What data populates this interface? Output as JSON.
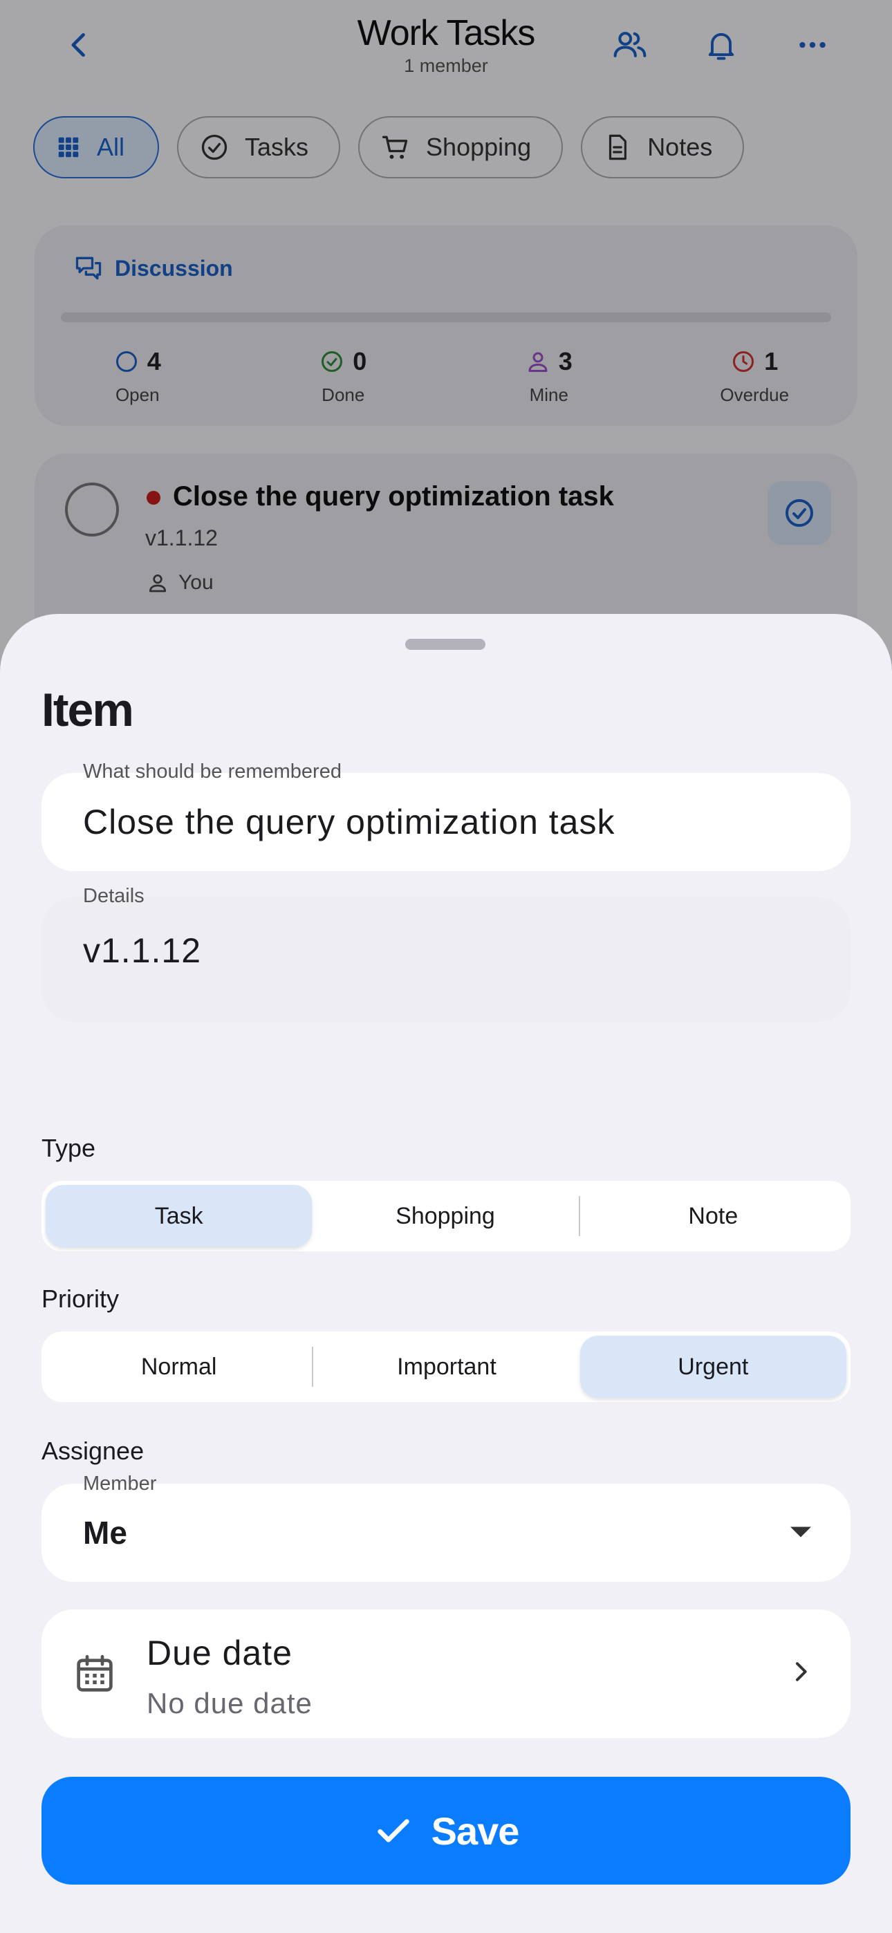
{
  "header": {
    "title": "Work Tasks",
    "subtitle": "1 member"
  },
  "filters": [
    {
      "label": "All",
      "icon": "grid-icon",
      "active": true
    },
    {
      "label": "Tasks",
      "icon": "check-circle-icon",
      "active": false
    },
    {
      "label": "Shopping",
      "icon": "cart-icon",
      "active": false
    },
    {
      "label": "Notes",
      "icon": "document-icon",
      "active": false
    }
  ],
  "discussion": {
    "label": "Discussion",
    "stats": [
      {
        "value": "4",
        "label": "Open",
        "color": "#1a5fc8"
      },
      {
        "value": "0",
        "label": "Done",
        "color": "#2e8b3a"
      },
      {
        "value": "3",
        "label": "Mine",
        "color": "#9b4fc9"
      },
      {
        "value": "1",
        "label": "Overdue",
        "color": "#d03030"
      }
    ]
  },
  "task": {
    "title": "Close the query optimization task",
    "version": "v1.1.12",
    "owner": "You",
    "priority_color": "#c81e1e"
  },
  "sheet": {
    "title": "Item",
    "remember": {
      "label": "What should be remembered",
      "value": "Close the query optimization task"
    },
    "details": {
      "label": "Details",
      "value": "v1.1.12"
    },
    "type": {
      "label": "Type",
      "options": [
        "Task",
        "Shopping",
        "Note"
      ],
      "selected": "Task"
    },
    "priority": {
      "label": "Priority",
      "options": [
        "Normal",
        "Important",
        "Urgent"
      ],
      "selected": "Urgent"
    },
    "assignee": {
      "label": "Assignee",
      "field_label": "Member",
      "value": "Me"
    },
    "due": {
      "title": "Due date",
      "value": "No due date"
    },
    "save_label": "Save"
  },
  "colors": {
    "accent": "#0a7cff",
    "selected_segment": "#d8e6f8"
  }
}
